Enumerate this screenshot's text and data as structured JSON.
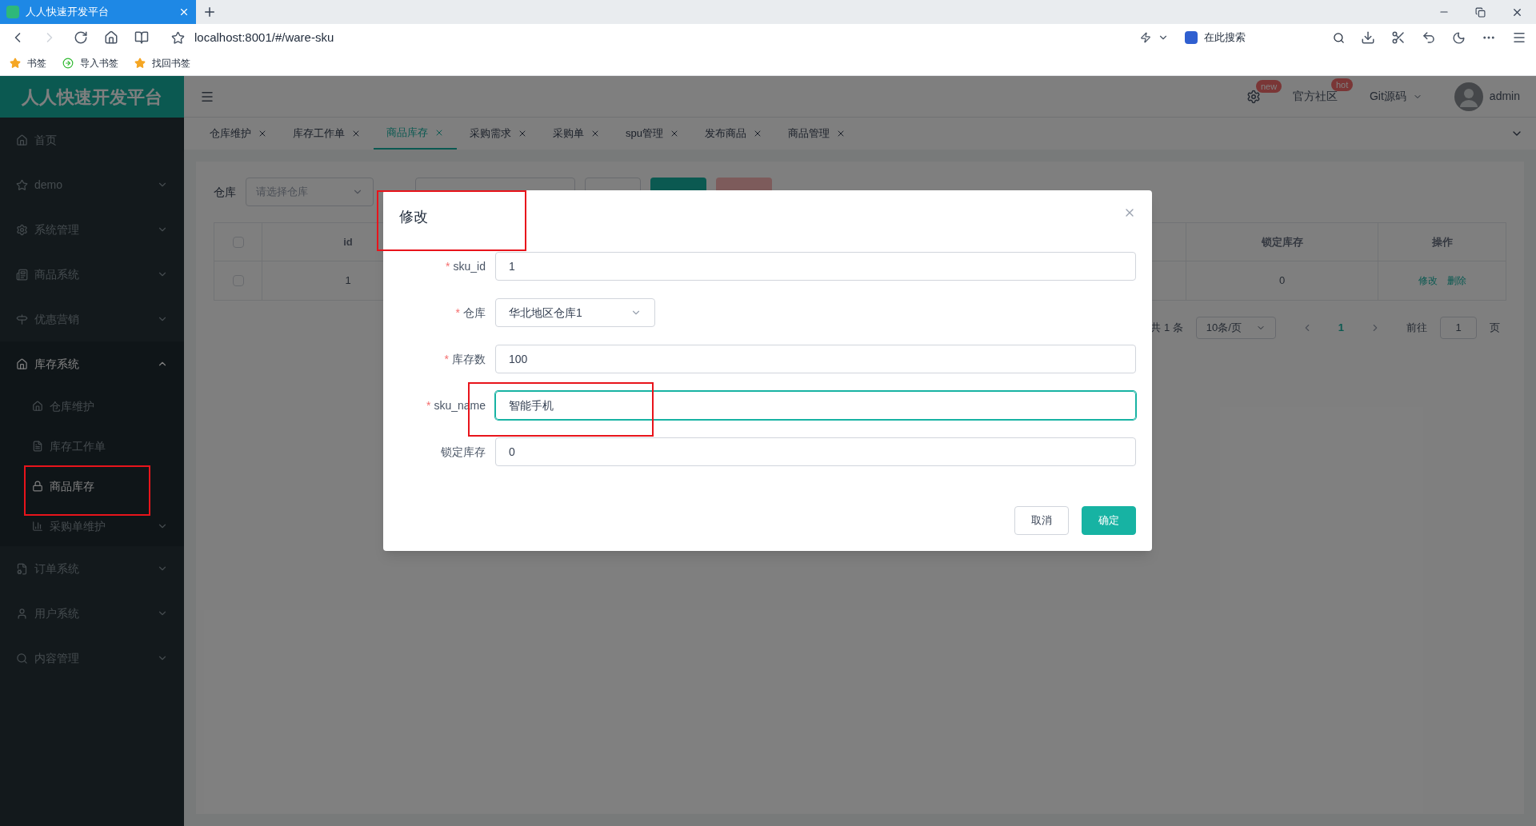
{
  "browser": {
    "tab_title": "人人快速开发平台",
    "url": "localhost:8001/#/ware-sku",
    "search_placeholder": "在此搜索",
    "bookmarks": [
      "书签",
      "导入书签",
      "找回书签"
    ]
  },
  "app": {
    "logo": "人人快速开发平台",
    "header": {
      "settings_badge": "new",
      "community": "官方社区",
      "community_badge": "hot",
      "git": "Git源码",
      "user": "admin"
    }
  },
  "tabs": [
    {
      "label": "仓库维护",
      "selected": false
    },
    {
      "label": "库存工作单",
      "selected": false
    },
    {
      "label": "商品库存",
      "selected": true
    },
    {
      "label": "采购需求",
      "selected": false
    },
    {
      "label": "采购单",
      "selected": false
    },
    {
      "label": "spu管理",
      "selected": false
    },
    {
      "label": "发布商品",
      "selected": false
    },
    {
      "label": "商品管理",
      "selected": false
    }
  ],
  "sidebar": {
    "items": [
      {
        "label": "首页",
        "expandable": false,
        "expanded": false
      },
      {
        "label": "demo",
        "expandable": true,
        "expanded": false
      },
      {
        "label": "系统管理",
        "expandable": true,
        "expanded": false
      },
      {
        "label": "商品系统",
        "expandable": true,
        "expanded": false
      },
      {
        "label": "优惠营销",
        "expandable": true,
        "expanded": false
      },
      {
        "label": "库存系统",
        "expandable": true,
        "expanded": true,
        "children": [
          {
            "label": "仓库维护",
            "selected": false,
            "expandable": false
          },
          {
            "label": "库存工作单",
            "selected": false,
            "expandable": false
          },
          {
            "label": "商品库存",
            "selected": true,
            "expandable": false
          },
          {
            "label": "采购单维护",
            "selected": false,
            "expandable": true
          }
        ]
      },
      {
        "label": "订单系统",
        "expandable": true,
        "expanded": false
      },
      {
        "label": "用户系统",
        "expandable": true,
        "expanded": false
      },
      {
        "label": "内容管理",
        "expandable": true,
        "expanded": false
      }
    ]
  },
  "filter": {
    "label": "仓库",
    "placeholder": "请选择仓库",
    "buttons": [
      {
        "kind": "default"
      },
      {
        "kind": "primary"
      },
      {
        "kind": "danger"
      }
    ]
  },
  "table": {
    "all_checked": false,
    "columns": [
      "id",
      "锁定库存",
      "操作"
    ],
    "rows": [
      {
        "checked": false,
        "id": "1",
        "locked": "0",
        "actions": [
          "修改",
          "删除"
        ]
      }
    ]
  },
  "pagination": {
    "total": "共 1 条",
    "page_size": "10条/页",
    "pages": [
      {
        "label": "1",
        "selected": true
      }
    ],
    "goto_label": "前往",
    "goto_value": "1",
    "goto_suffix": "页"
  },
  "dialog": {
    "title": "修改",
    "fields": [
      {
        "label": "sku_id",
        "required_mark": "*",
        "kind": "input",
        "value": "1",
        "focused": false
      },
      {
        "label": "仓库",
        "required_mark": "*",
        "kind": "select",
        "value": "华北地区仓库1"
      },
      {
        "label": "库存数",
        "required_mark": "*",
        "kind": "input",
        "value": "100",
        "focused": false
      },
      {
        "label": "sku_name",
        "required_mark": "*",
        "kind": "input",
        "value": "智能手机",
        "focused": true
      },
      {
        "label": "锁定库存",
        "kind": "input",
        "value": "0",
        "focused": false
      }
    ],
    "buttons": [
      {
        "label": "取消",
        "kind": "default"
      },
      {
        "label": "确定",
        "kind": "primary"
      }
    ]
  }
}
